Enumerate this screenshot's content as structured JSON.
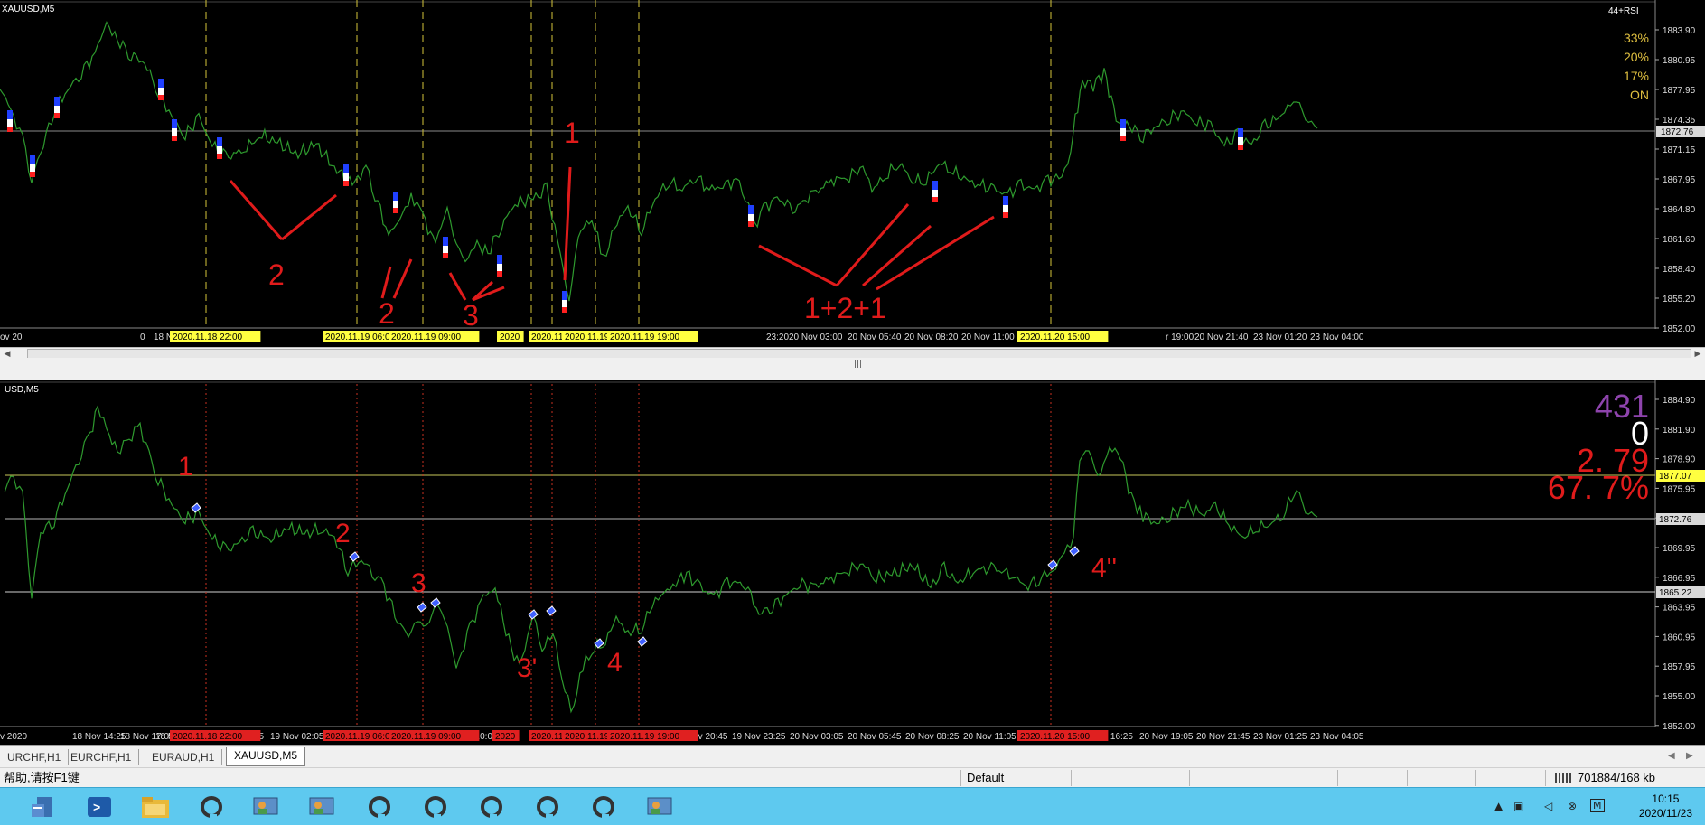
{
  "top_chart": {
    "symbol_label": "XAUUSD,M5",
    "indicator_label": "44+RSI",
    "percentages": [
      "33%",
      "20%",
      "17%",
      "ON"
    ],
    "price_axis": [
      "1883.90",
      "1880.95",
      "1877.95",
      "1874.35",
      "1871.15",
      "1867.95",
      "1864.80",
      "1861.60",
      "1858.40",
      "1855.20",
      "1852.00"
    ],
    "current_price": "1872.76",
    "time_axis": [
      "ov 20",
      "0",
      "18 N",
      "23:20",
      "20 Nov 03:00",
      "20 Nov 05:40",
      "20 Nov 08:20",
      "20 Nov 11:00",
      "r 19:00",
      "20 Nov 21:40",
      "23 Nov 01:20",
      "23 Nov 04:00"
    ],
    "highlight_times": [
      "2020.11.18 22:00",
      "2020.11.19 06:00",
      "2020.11.19 09:00",
      "2020",
      "2020.11.19",
      "2020.11.19",
      "2020.11.19 19:00",
      "2020.11.20 15:00"
    ],
    "annotations": [
      "2",
      "2",
      "3",
      "1",
      "1+2+1"
    ]
  },
  "scrollbar": {
    "grip": "|||"
  },
  "bottom_chart": {
    "symbol_label": "USD,M5",
    "stats": [
      "431",
      "0",
      "2. 79",
      "67. 7%"
    ],
    "price_axis": [
      "1884.90",
      "1881.90",
      "1878.90",
      "1875.95",
      "1872.95",
      "1869.95",
      "1866.95",
      "1863.95",
      "1860.95",
      "1857.95",
      "1855.00",
      "1852.00"
    ],
    "level_labels": [
      "1877.07",
      "1872.76",
      "1865.22"
    ],
    "time_axis": [
      "v 2020",
      "18 Nov 14:25",
      "18 Nov 17:05",
      "18 N",
      "22:25",
      "19 Nov 02:05",
      "Nov 10:05",
      "19 Nov 20:45",
      "19 Nov 23:25",
      "20 Nov 03:05",
      "20 Nov 05:45",
      "20 Nov 08:25",
      "20 Nov 11:05",
      "0 Nov 16:25",
      "20 Nov 19:05",
      "20 Nov 21:45",
      "23 Nov 01:25",
      "23 Nov 04:05"
    ],
    "highlight_times": [
      "2020.11.18 22:00",
      "2020.11.19 06:00",
      "2020.11.19 09:00",
      "2020",
      "2020.11.19",
      "2020.11.19",
      "2020.11.19 19:00",
      "2020.11.20 15:00"
    ],
    "annotations": [
      "1",
      "2",
      "3",
      "3'",
      "4",
      "4''"
    ]
  },
  "tabs": [
    "URCHF,H1",
    "EURCHF,H1",
    "EURAUD,H1",
    "XAUUSD,M5"
  ],
  "status": {
    "help": "帮助,请按F1键",
    "profile": "Default",
    "memory": "701884/168 kb"
  },
  "taskbar": {
    "time": "10:15",
    "date": "2020/11/23",
    "tray_m": "M"
  }
}
